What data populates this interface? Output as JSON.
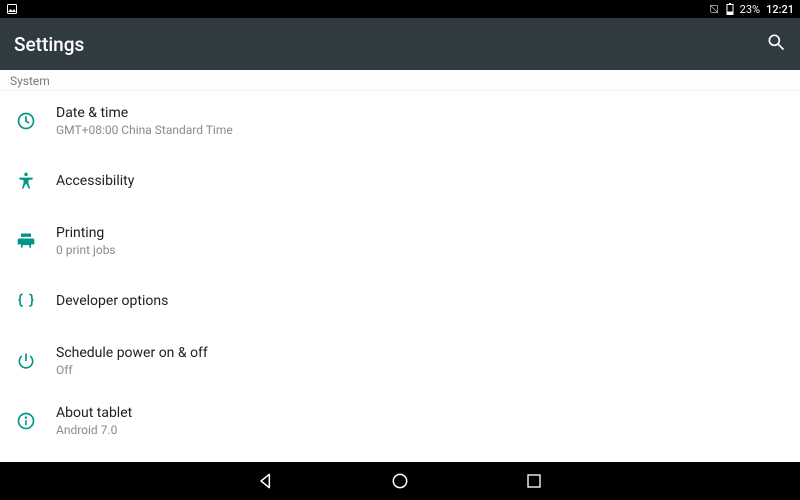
{
  "status": {
    "battery_pct": "23%",
    "clock": "12:21"
  },
  "header": {
    "title": "Settings"
  },
  "section": {
    "label": "System"
  },
  "items": [
    {
      "title": "Date & time",
      "sub": "GMT+08:00 China Standard Time",
      "icon": "clock-icon"
    },
    {
      "title": "Accessibility",
      "sub": "",
      "icon": "accessibility-icon"
    },
    {
      "title": "Printing",
      "sub": "0 print jobs",
      "icon": "print-icon"
    },
    {
      "title": "Developer options",
      "sub": "",
      "icon": "code-braces-icon"
    },
    {
      "title": "Schedule power on & off",
      "sub": "Off",
      "icon": "power-icon"
    },
    {
      "title": "About tablet",
      "sub": "Android 7.0",
      "icon": "info-icon"
    }
  ],
  "colors": {
    "accent": "#009688"
  }
}
